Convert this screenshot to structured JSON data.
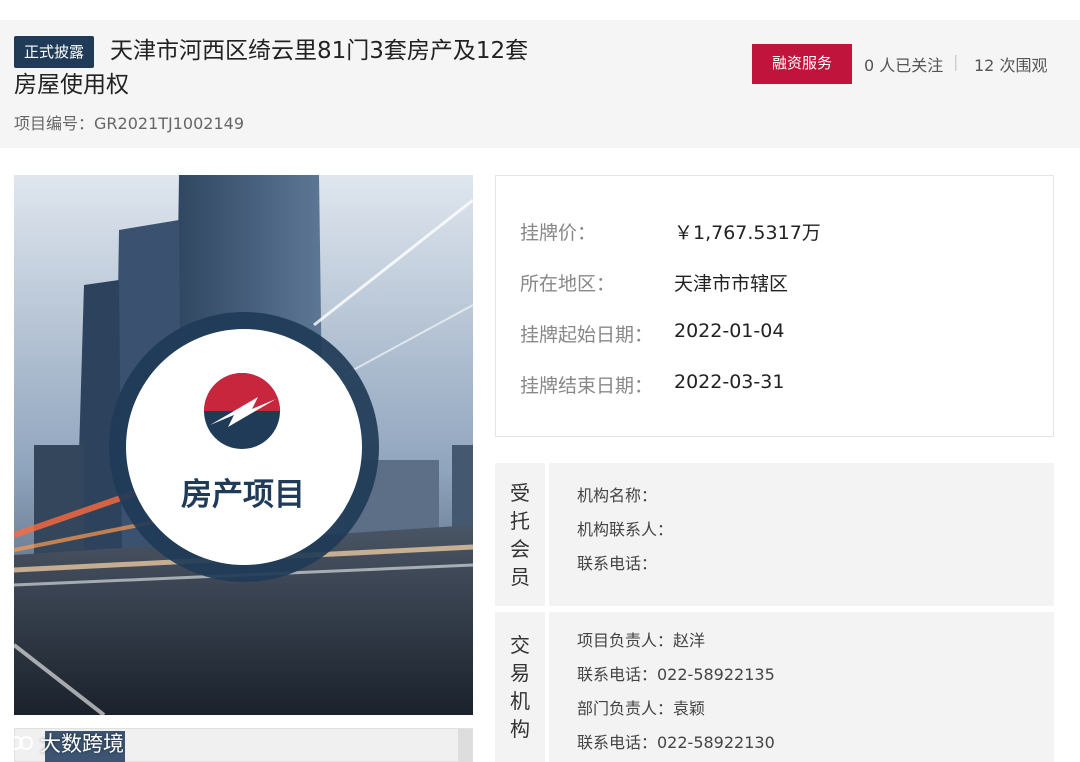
{
  "header": {
    "badge": "正式披露",
    "title": "天津市河西区绮云里81门3套房产及12套房屋使用权",
    "project_no_label": "项目编号：",
    "project_no": "GR2021TJ1002149",
    "finance_button": "融资服务",
    "followers": "0 人已关注",
    "views": "12 次围观",
    "separator": "|"
  },
  "hero": {
    "caption": "房产项目"
  },
  "watermark": {
    "text": "大数跨境"
  },
  "listing": {
    "rows": [
      {
        "label": "挂牌价：",
        "value": "￥1,767.5317万"
      },
      {
        "label": "所在地区：",
        "value": "天津市市辖区"
      },
      {
        "label": "挂牌起始日期：",
        "value": "2022-01-04"
      },
      {
        "label": "挂牌结束日期：",
        "value": "2022-03-31"
      }
    ]
  },
  "member": {
    "label_chars": [
      "受",
      "托",
      "会",
      "员"
    ],
    "lines": [
      "机构名称：",
      "机构联系人：",
      "联系电话："
    ]
  },
  "trade": {
    "label_chars": [
      "交",
      "易",
      "机",
      "构"
    ],
    "lines": [
      "项目负责人：赵洋",
      "联系电话：022-58922135",
      "部门负责人：袁颖",
      "联系电话：022-58922130"
    ]
  },
  "colors": {
    "badge": "#1f3b57",
    "finance_button": "#c0143c",
    "header_bg": "#f5f5f5",
    "logo_red": "#c8263d",
    "logo_navy": "#1f3b57"
  }
}
